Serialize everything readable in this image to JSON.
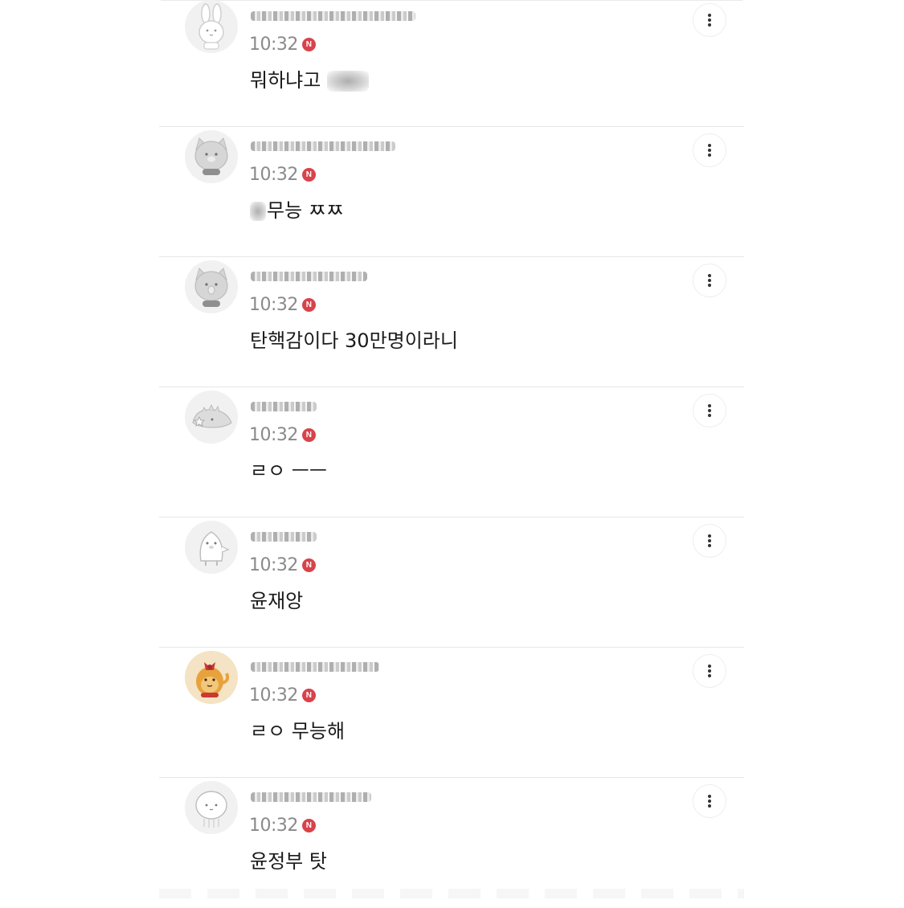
{
  "comments": [
    {
      "time": "10:32",
      "badge": "N",
      "text": "뭐하냐고 ",
      "text_suffix": "",
      "avatar": "rabbit-avatar-icon"
    },
    {
      "time": "10:32",
      "badge": "N",
      "text": "",
      "text_suffix": "무능 ㅉㅉ",
      "avatar": "cat-avatar-icon"
    },
    {
      "time": "10:32",
      "badge": "N",
      "text": "탄핵감이다 30만명이라니",
      "text_suffix": "",
      "avatar": "cat-avatar-icon"
    },
    {
      "time": "10:32",
      "badge": "N",
      "text": "ㄹㅇ ㅡㅡ",
      "text_suffix": "",
      "avatar": "dinosaur-avatar-icon"
    },
    {
      "time": "10:32",
      "badge": "N",
      "text": "윤재앙",
      "text_suffix": "",
      "avatar": "penguin-avatar-icon"
    },
    {
      "time": "10:32",
      "badge": "N",
      "text": "ㄹㅇ 무능해",
      "text_suffix": "",
      "avatar": "lion-avatar-icon"
    },
    {
      "time": "10:32",
      "badge": "N",
      "text": "윤정부 탓",
      "text_suffix": "",
      "avatar": "blob-avatar-icon"
    }
  ],
  "colors": {
    "badge": "#d8434b",
    "time": "#8a8a8a",
    "divider": "#e6e6e6",
    "text": "#1a1a1a"
  },
  "icons": {
    "more": "more-vertical-icon"
  }
}
